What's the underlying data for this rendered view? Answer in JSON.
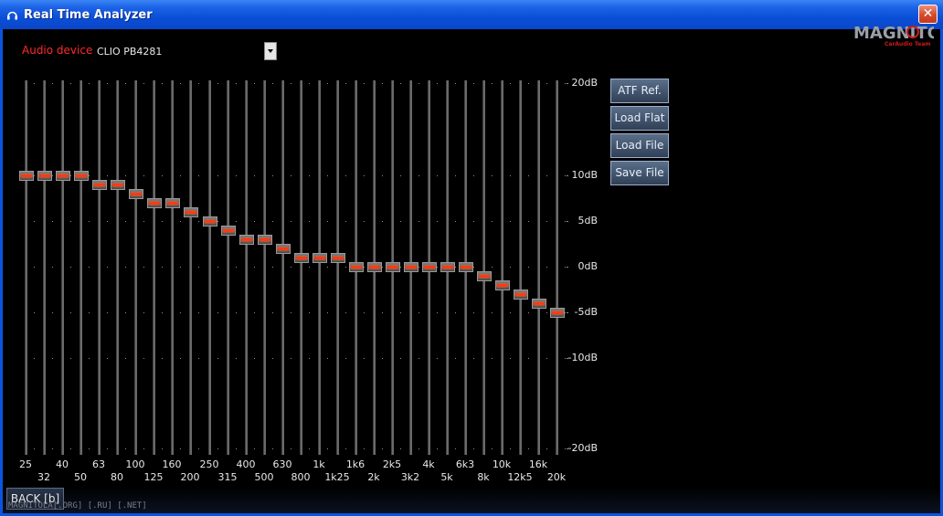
{
  "window": {
    "title": "Real Time Analyzer",
    "close_glyph": "✕"
  },
  "logo": {
    "text": "MAGNITOLA",
    "subtitle": "CarAudio Team"
  },
  "device": {
    "label": "Audio device",
    "value": "CLIO PB4281"
  },
  "db_scale": [
    {
      "label": "20dB",
      "value": 20
    },
    {
      "label": "10dB",
      "value": 10
    },
    {
      "label": "5dB",
      "value": 5
    },
    {
      "label": "0dB",
      "value": 0
    },
    {
      "label": "-5dB",
      "value": -5
    },
    {
      "label": "-10dB",
      "value": -10
    },
    {
      "label": "-20dB",
      "value": -20
    }
  ],
  "bands": [
    {
      "freq": "25",
      "gain": 10
    },
    {
      "freq": "32",
      "gain": 10
    },
    {
      "freq": "40",
      "gain": 10
    },
    {
      "freq": "50",
      "gain": 10
    },
    {
      "freq": "63",
      "gain": 9
    },
    {
      "freq": "80",
      "gain": 9
    },
    {
      "freq": "100",
      "gain": 8
    },
    {
      "freq": "125",
      "gain": 7
    },
    {
      "freq": "160",
      "gain": 7
    },
    {
      "freq": "200",
      "gain": 6
    },
    {
      "freq": "250",
      "gain": 5
    },
    {
      "freq": "315",
      "gain": 4
    },
    {
      "freq": "400",
      "gain": 3
    },
    {
      "freq": "500",
      "gain": 3
    },
    {
      "freq": "630",
      "gain": 2
    },
    {
      "freq": "800",
      "gain": 1
    },
    {
      "freq": "1k",
      "gain": 1
    },
    {
      "freq": "1k25",
      "gain": 1
    },
    {
      "freq": "1k6",
      "gain": 0
    },
    {
      "freq": "2k",
      "gain": 0
    },
    {
      "freq": "2k5",
      "gain": 0
    },
    {
      "freq": "3k2",
      "gain": 0
    },
    {
      "freq": "4k",
      "gain": 0
    },
    {
      "freq": "5k",
      "gain": 0
    },
    {
      "freq": "6k3",
      "gain": 0
    },
    {
      "freq": "8k",
      "gain": -1
    },
    {
      "freq": "10k",
      "gain": -2
    },
    {
      "freq": "12k5",
      "gain": -3
    },
    {
      "freq": "16k",
      "gain": -4
    },
    {
      "freq": "20k",
      "gain": -5
    }
  ],
  "buttons": {
    "atf_ref": "ATF Ref.",
    "load_flat": "Load Flat",
    "load_file": "Load File",
    "save_file": "Save File"
  },
  "footer": {
    "back_label": "BACK [b]",
    "site_text": "MAGNITOLA[.ORG] [.RU] [.NET]"
  },
  "colors": {
    "knob_led": "#ff3a14",
    "device_label": "#ff2a2a",
    "title_bar": "#0a55e0"
  }
}
